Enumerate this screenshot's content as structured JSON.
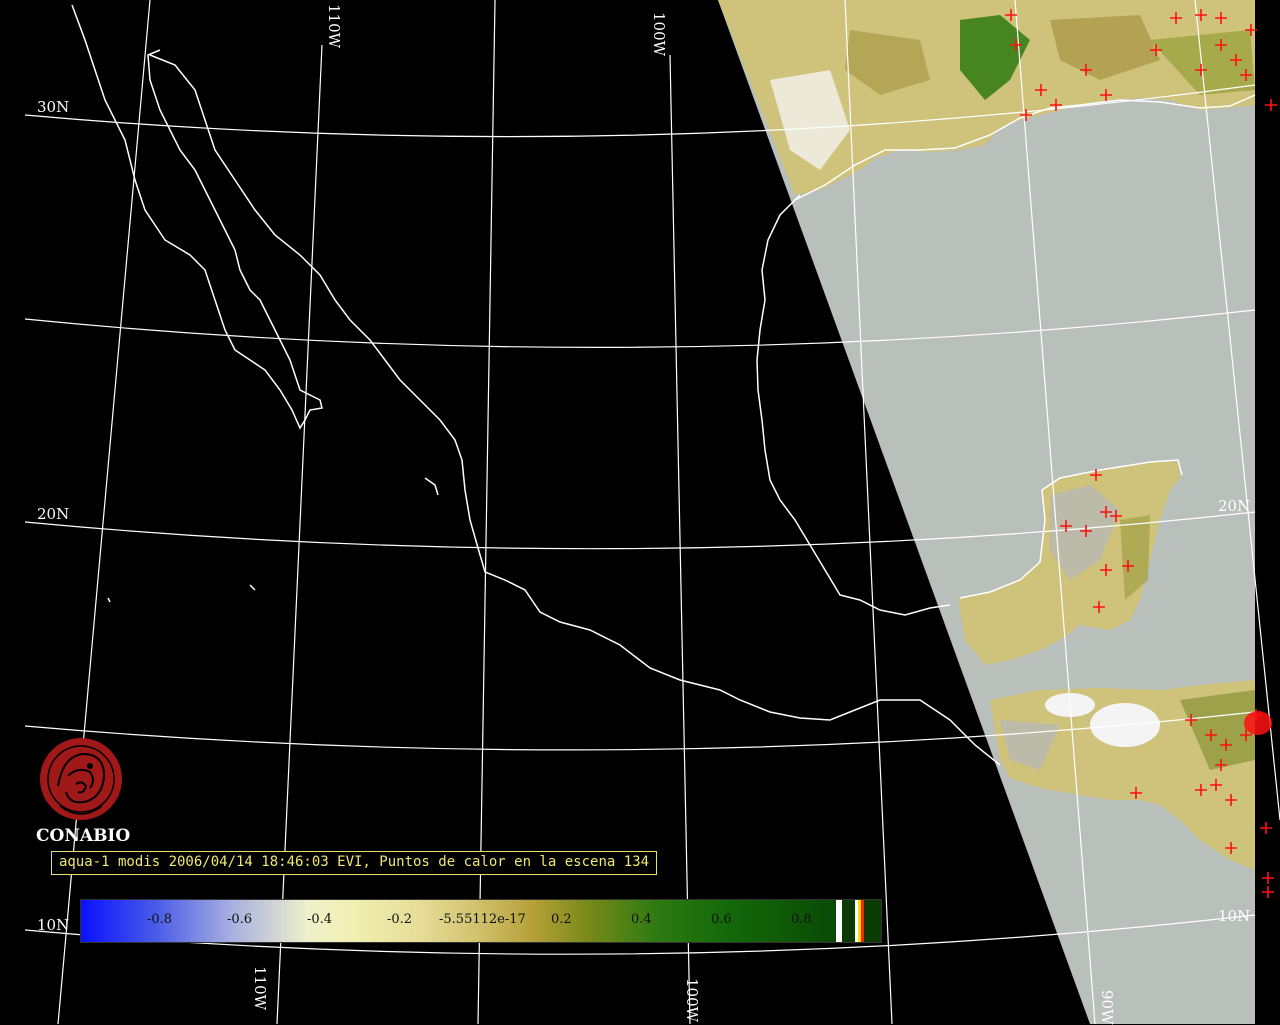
{
  "map": {
    "graticule_labels": {
      "lat_30n": "30N",
      "lat_20n_left": "20N",
      "lat_20n_right": "20N",
      "lat_10n_left": "10N",
      "lat_10n_right": "10N",
      "lon_110w_top": "110W",
      "lon_100w_top": "100W",
      "lon_110w_bottom": "110W",
      "lon_100w_bottom": "100W",
      "lon_90w_bottom": "90W"
    },
    "colors": {
      "background": "#000000",
      "graticule": "#ffffff",
      "coastline": "#ffffff",
      "ocean_swath": "#b9bfba",
      "land_swath": "#cfc27a",
      "vegetation": "#2f7a12",
      "hotspot": "#ff1010"
    }
  },
  "logo": {
    "name": "CONABIO",
    "color": "#a01818"
  },
  "caption": "aqua-1 modis 2006/04/14 18:46:03 EVI, Puntos de calor en la escena 134",
  "colorbar": {
    "ticks": [
      "-0.8",
      "-0.6",
      "-0.4",
      "-0.2",
      "-5.55112e-17",
      "0.2",
      "0.4",
      "0.6",
      "0.8"
    ]
  }
}
